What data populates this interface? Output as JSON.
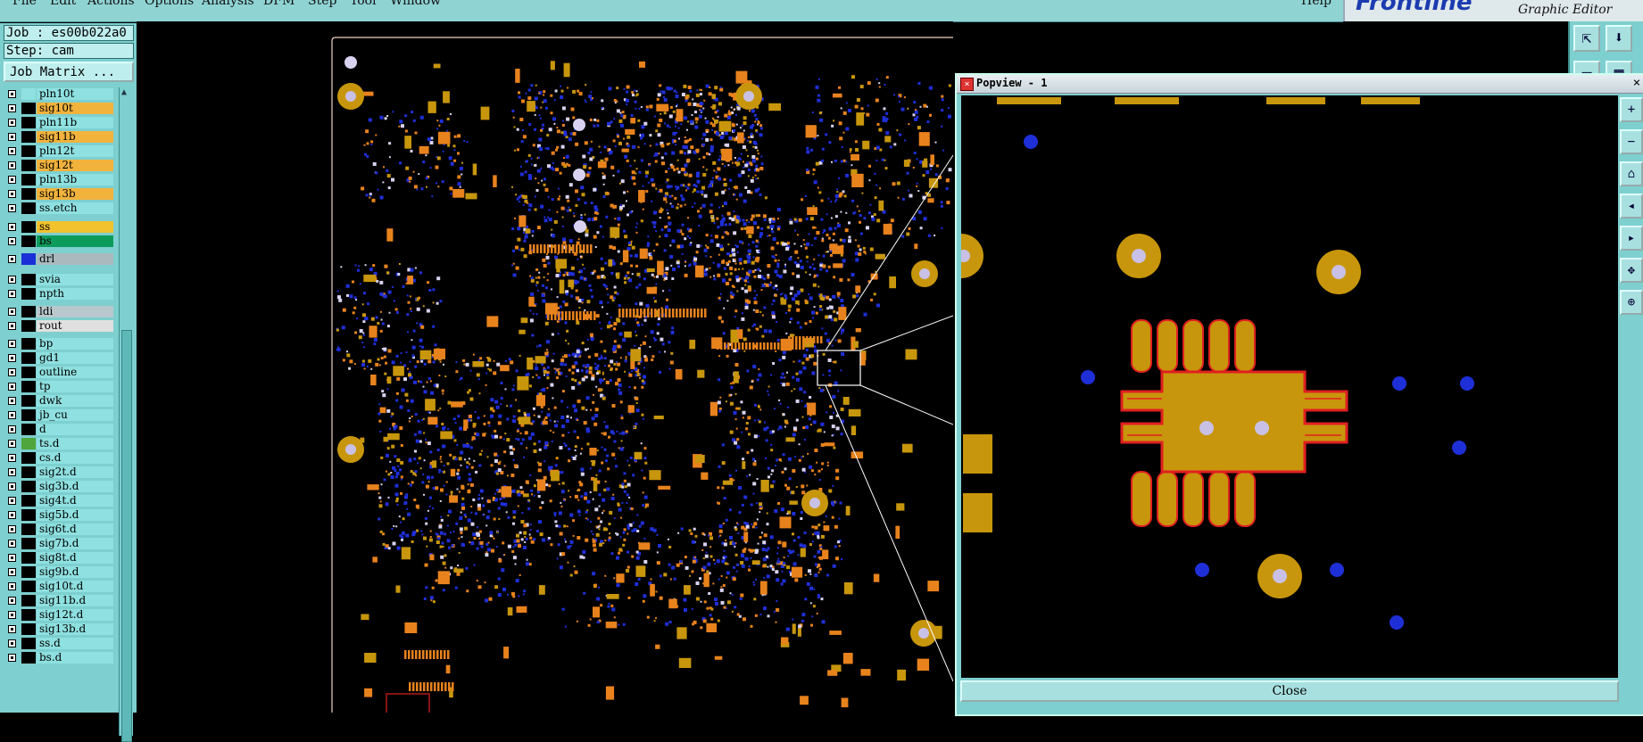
{
  "menu": {
    "items": [
      "File",
      "Edit",
      "Actions",
      "Options",
      "Analysis",
      "DFM",
      "Step",
      "Tool",
      "Window"
    ],
    "help": "Help"
  },
  "brand": {
    "logo": "Frontline",
    "subtitle": "Graphic Editor"
  },
  "job": {
    "job_label": "Job : es00b022a0",
    "step_label": "Step: cam",
    "matrix_button": "Job Matrix ..."
  },
  "layers": [
    {
      "name": "pln10t",
      "color": "#8fe0e0",
      "name_bg": "#8fe0e0"
    },
    {
      "name": "sig10t",
      "color": "#000000",
      "name_bg": "#f2b33d"
    },
    {
      "name": "pln11b",
      "color": "#000000",
      "name_bg": "#8fe0e0"
    },
    {
      "name": "sig11b",
      "color": "#000000",
      "name_bg": "#f2b33d"
    },
    {
      "name": "pln12t",
      "color": "#000000",
      "name_bg": "#8fe0e0"
    },
    {
      "name": "sig12t",
      "color": "#000000",
      "name_bg": "#f2b33d"
    },
    {
      "name": "pln13b",
      "color": "#000000",
      "name_bg": "#8fe0e0"
    },
    {
      "name": "sig13b",
      "color": "#000000",
      "name_bg": "#f2b33d"
    },
    {
      "name": "ss.etch",
      "color": "#000000",
      "name_bg": "#8fe0e0"
    },
    {
      "name": "ss",
      "color": "#000000",
      "name_bg": "#f2c12e"
    },
    {
      "name": "bs",
      "color": "#000000",
      "name_bg": "#0d9b5c"
    },
    {
      "name": "drl",
      "color": "#1a2fd6",
      "name_bg": "#a9b9be"
    },
    {
      "name": "svia",
      "color": "#000000",
      "name_bg": "#8fe0e0"
    },
    {
      "name": "npth",
      "color": "#000000",
      "name_bg": "#8fe0e0"
    },
    {
      "name": "ldi",
      "color": "#000000",
      "name_bg": "#b8c8cc"
    },
    {
      "name": "rout",
      "color": "#000000",
      "name_bg": "#e0e0e0"
    },
    {
      "name": "bp",
      "color": "#000000",
      "name_bg": "#8fe0e0"
    },
    {
      "name": "gd1",
      "color": "#000000",
      "name_bg": "#8fe0e0"
    },
    {
      "name": "outline",
      "color": "#000000",
      "name_bg": "#8fe0e0"
    },
    {
      "name": "tp",
      "color": "#000000",
      "name_bg": "#8fe0e0"
    },
    {
      "name": "dwk",
      "color": "#000000",
      "name_bg": "#8fe0e0"
    },
    {
      "name": "jb_cu",
      "color": "#000000",
      "name_bg": "#8fe0e0"
    },
    {
      "name": "d",
      "color": "#000000",
      "name_bg": "#8fe0e0"
    },
    {
      "name": "ts.d",
      "color": "#4fa63d",
      "name_bg": "#8fe0e0"
    },
    {
      "name": "cs.d",
      "color": "#000000",
      "name_bg": "#8fe0e0"
    },
    {
      "name": "sig2t.d",
      "color": "#000000",
      "name_bg": "#8fe0e0"
    },
    {
      "name": "sig3b.d",
      "color": "#000000",
      "name_bg": "#8fe0e0"
    },
    {
      "name": "sig4t.d",
      "color": "#000000",
      "name_bg": "#8fe0e0"
    },
    {
      "name": "sig5b.d",
      "color": "#000000",
      "name_bg": "#8fe0e0"
    },
    {
      "name": "sig6t.d",
      "color": "#000000",
      "name_bg": "#8fe0e0"
    },
    {
      "name": "sig7b.d",
      "color": "#000000",
      "name_bg": "#8fe0e0"
    },
    {
      "name": "sig8t.d",
      "color": "#000000",
      "name_bg": "#8fe0e0"
    },
    {
      "name": "sig9b.d",
      "color": "#000000",
      "name_bg": "#8fe0e0"
    },
    {
      "name": "sig10t.d",
      "color": "#000000",
      "name_bg": "#8fe0e0"
    },
    {
      "name": "sig11b.d",
      "color": "#000000",
      "name_bg": "#8fe0e0"
    },
    {
      "name": "sig12t.d",
      "color": "#000000",
      "name_bg": "#8fe0e0"
    },
    {
      "name": "sig13b.d",
      "color": "#000000",
      "name_bg": "#8fe0e0"
    },
    {
      "name": "ss.d",
      "color": "#000000",
      "name_bg": "#8fe0e0"
    },
    {
      "name": "bs.d",
      "color": "#000000",
      "name_bg": "#8fe0e0"
    }
  ],
  "popview": {
    "title": "Popview - 1",
    "close_label": "Close"
  },
  "colors": {
    "copper": "#c8960c",
    "pad_orange": "#e8821c",
    "via_blue": "#1f2fd8",
    "hole": "#c9c0e6",
    "outline_red": "#e02020"
  }
}
